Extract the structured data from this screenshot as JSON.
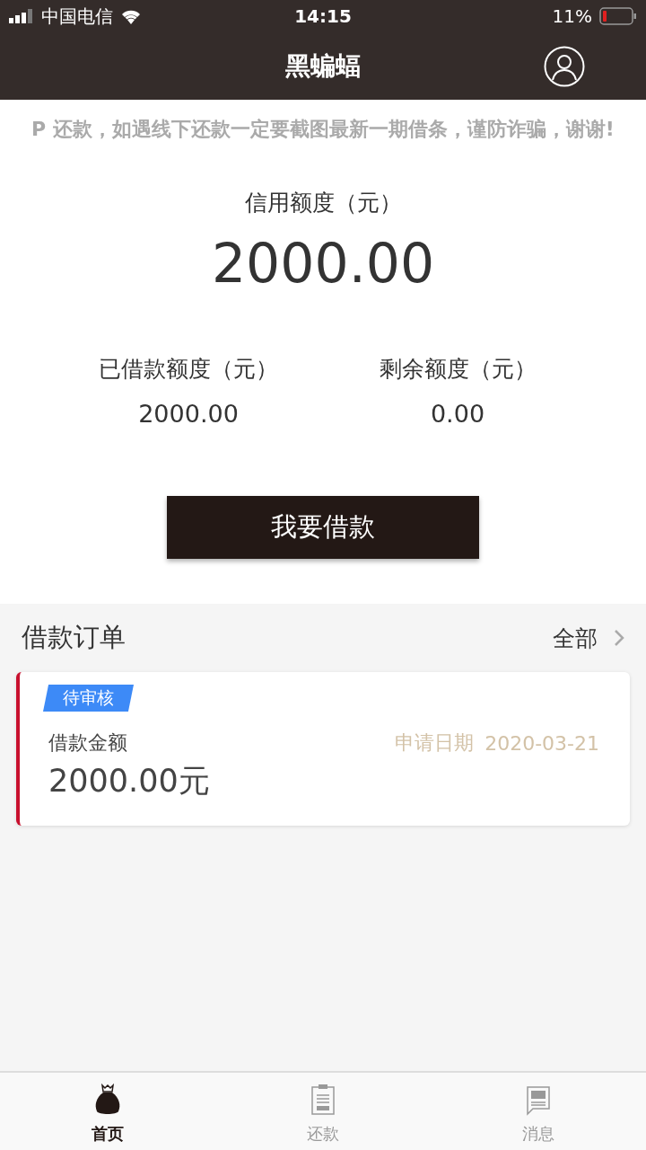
{
  "status_bar": {
    "carrier": "中国电信",
    "time": "14:15",
    "battery": "11%"
  },
  "nav": {
    "title": "黑蝙蝠"
  },
  "notice": "P 还款，如遇线下还款一定要截图最新一期借条，谨防诈骗，谢谢!",
  "credit": {
    "label": "信用额度（元）",
    "value": "2000.00"
  },
  "stats": [
    {
      "label": "已借款额度（元）",
      "value": "2000.00"
    },
    {
      "label": "剩余额度（元）",
      "value": "0.00"
    }
  ],
  "borrow_button": "我要借款",
  "orders": {
    "title": "借款订单",
    "all_link": "全部",
    "items": [
      {
        "status": "待审核",
        "amount_label": "借款金额",
        "amount": "2000.00元",
        "date_label": "申请日期",
        "date": "2020-03-21"
      }
    ]
  },
  "tabs": [
    {
      "label": "首页",
      "kind": "bag",
      "selected": true
    },
    {
      "label": "还款",
      "kind": "clipboard",
      "selected": false
    },
    {
      "label": "消息",
      "kind": "message",
      "selected": false
    }
  ]
}
